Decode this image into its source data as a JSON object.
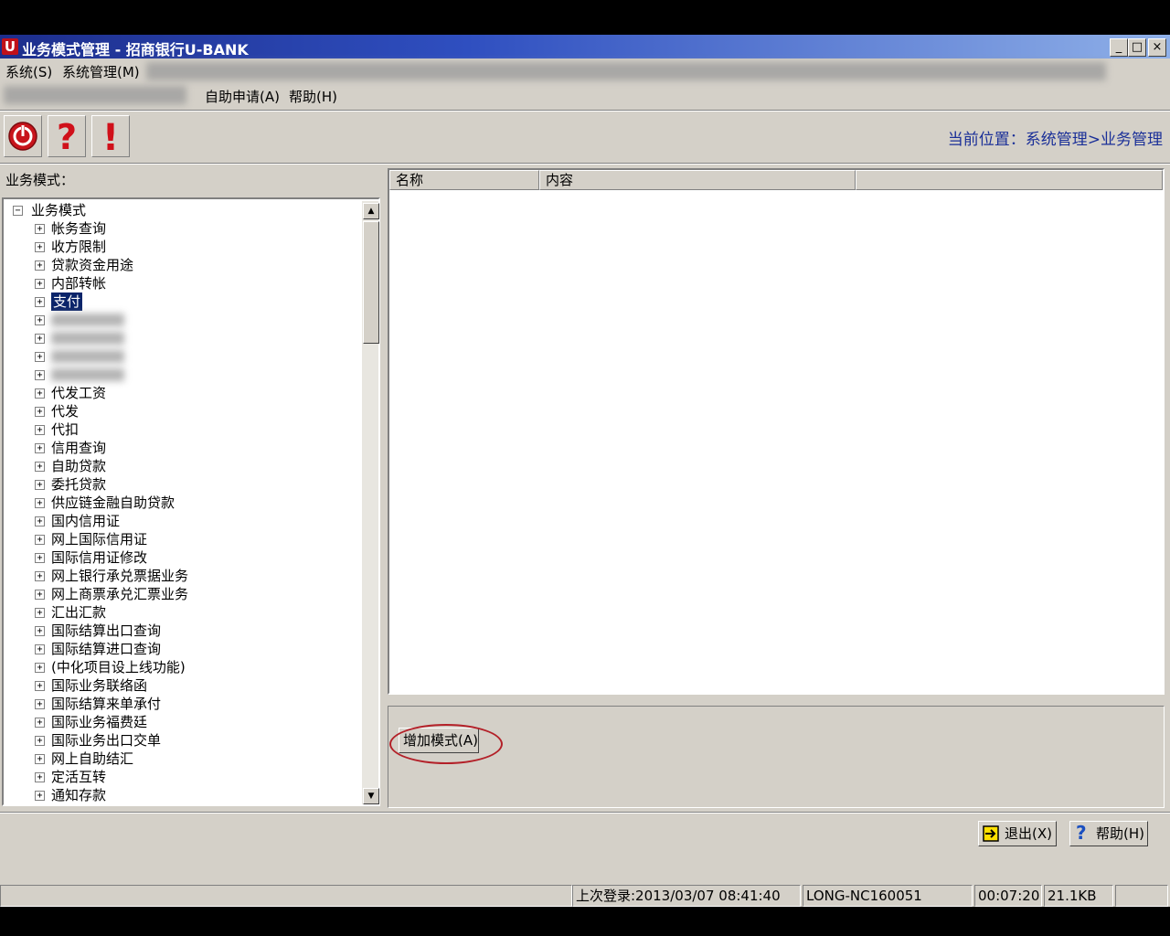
{
  "window": {
    "title": "业务模式管理 - 招商银行U-BANK",
    "app_icon": "U",
    "controls": [
      "_",
      "□",
      "×"
    ]
  },
  "menu": {
    "row1": [
      "系统(S)",
      "系统管理(M)"
    ],
    "row2": [
      "自助申请(A)",
      "帮助(H)"
    ]
  },
  "toolbar": {
    "icons": [
      "power-icon",
      "question-icon",
      "exclamation-icon"
    ],
    "location": "当前位置：系统管理>业务管理"
  },
  "left": {
    "label": "业务模式：",
    "root": "业务模式",
    "items": [
      "帐务查询",
      "收方限制",
      "贷款资金用途",
      "内部转帐",
      "支付",
      "",
      "",
      "",
      "",
      "代发工资",
      "代发",
      "代扣",
      "信用查询",
      "自助贷款",
      "委托贷款",
      "供应链金融自助贷款",
      "国内信用证",
      "网上国际信用证",
      "国际信用证修改",
      "网上银行承兑票据业务",
      "网上商票承兑汇票业务",
      "汇出汇款",
      "国际结算出口查询",
      "国际结算进口查询",
      "(中化项目设上线功能)",
      "国际业务联络函",
      "国际结算来单承付",
      "国际业务福费廷",
      "国际业务出口交单",
      "网上自助结汇",
      "定活互转",
      "通知存款"
    ],
    "selected_index": 4
  },
  "list": {
    "columns": [
      "名称",
      "内容",
      ""
    ]
  },
  "buttons": {
    "add_mode": "增加模式(A)",
    "exit": "退出(X)",
    "help": "帮助(H)"
  },
  "status": {
    "last_login": "上次登录:2013/03/07 08:41:40",
    "host": "LONG-NC160051",
    "time": "00:07:20",
    "size": "21.1KB"
  },
  "colors": {
    "title_bar": "#1d2e8c",
    "selection": "#0a246a",
    "location_text": "#1a2f98",
    "highlight_oval": "#b32028"
  }
}
